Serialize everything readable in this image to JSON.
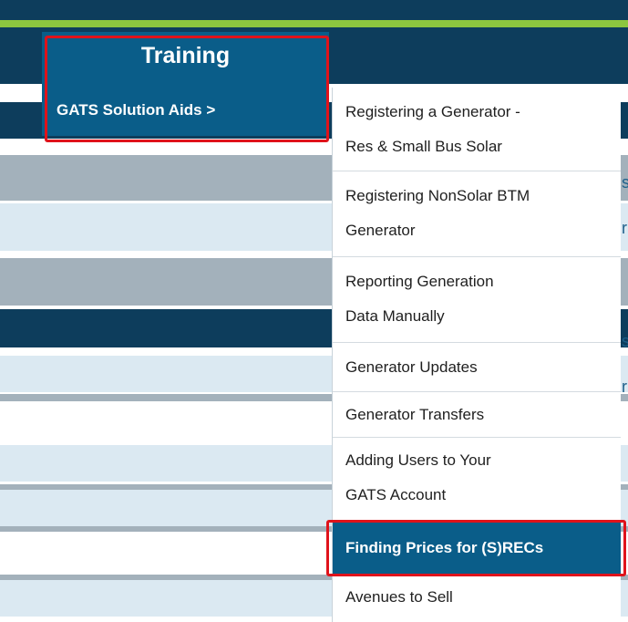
{
  "nav": {
    "training_label": "Training",
    "solution_aids_label": "GATS Solution Aids >"
  },
  "dropdown": {
    "items": [
      {
        "line1": "Registering a Generator -",
        "line2": "Res & Small Bus Solar"
      },
      {
        "line1": "Registering NonSolar BTM",
        "line2": "Generator"
      },
      {
        "line1": "Reporting Generation",
        "line2": "Data Manually"
      },
      {
        "line1": "Generator Updates",
        "line2": ""
      },
      {
        "line1": "Generator Transfers",
        "line2": ""
      },
      {
        "line1": "Adding Users to Your",
        "line2": "GATS Account"
      },
      {
        "line1": "Finding Prices for (S)RECs",
        "line2": ""
      },
      {
        "line1": "Avenues to Sell",
        "line2": ""
      }
    ]
  },
  "edge_text": [
    "s",
    "r",
    "s",
    "r"
  ],
  "colors": {
    "nav_bg": "#0d3d5c",
    "accent_green": "#8cc63f",
    "tab_blue": "#0a5d89",
    "highlight_red": "#e0131b",
    "row_light": "#dbe9f2",
    "row_gray": "#a3b1bb"
  }
}
